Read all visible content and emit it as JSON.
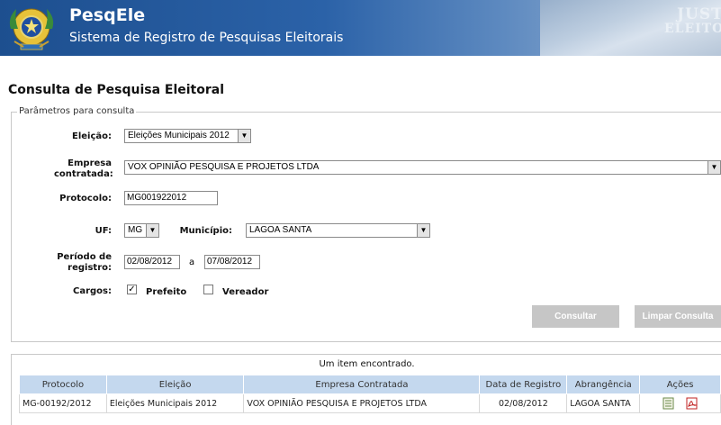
{
  "header": {
    "app_title": "PesqEle",
    "app_subtitle": "Sistema de Registro de Pesquisas Eleitorais",
    "photo_text_1": "JUSTI",
    "photo_text_2": "ELEITOR",
    "emblem_icon": "brazil-coat-of-arms-icon"
  },
  "page_title": "Consulta de Pesquisa Eleitoral",
  "form": {
    "legend": "Parâmetros para consulta",
    "eleicao": {
      "label": "Eleição:",
      "value": "Eleições Municipais 2012"
    },
    "empresa": {
      "label_line1": "Empresa",
      "label_line2": "contratada:",
      "value": "VOX OPINIÃO PESQUISA E PROJETOS LTDA"
    },
    "protocolo": {
      "label": "Protocolo:",
      "value": "MG001922012"
    },
    "uf": {
      "label": "UF:",
      "value": "MG"
    },
    "municipio": {
      "label": "Município:",
      "value": "LAGOA SANTA"
    },
    "periodo": {
      "label_line1": "Período de",
      "label_line2": "registro:",
      "from": "02/08/2012",
      "separator": "a",
      "to": "07/08/2012"
    },
    "cargos": {
      "label": "Cargos:",
      "options": [
        {
          "label": "Prefeito",
          "checked": true
        },
        {
          "label": "Vereador",
          "checked": false
        }
      ]
    },
    "buttons": {
      "consultar": "Consultar",
      "limpar": "Limpar Consulta"
    }
  },
  "results": {
    "count_text": "Um item encontrado.",
    "columns": [
      "Protocolo",
      "Eleição",
      "Empresa Contratada",
      "Data de Registro",
      "Abrangência",
      "Ações"
    ],
    "rows": [
      {
        "protocolo": "MG-00192/2012",
        "eleicao": "Eleições Municipais 2012",
        "empresa": "VOX OPINIÃO PESQUISA E PROJETOS LTDA",
        "data": "02/08/2012",
        "abrangencia": "LAGOA SANTA",
        "actions": [
          "document-icon",
          "pdf-icon"
        ]
      }
    ]
  },
  "colors": {
    "header_blue": "#1d4f8f",
    "table_header": "#c4d8ee",
    "button_gray": "#c6c6c6"
  }
}
